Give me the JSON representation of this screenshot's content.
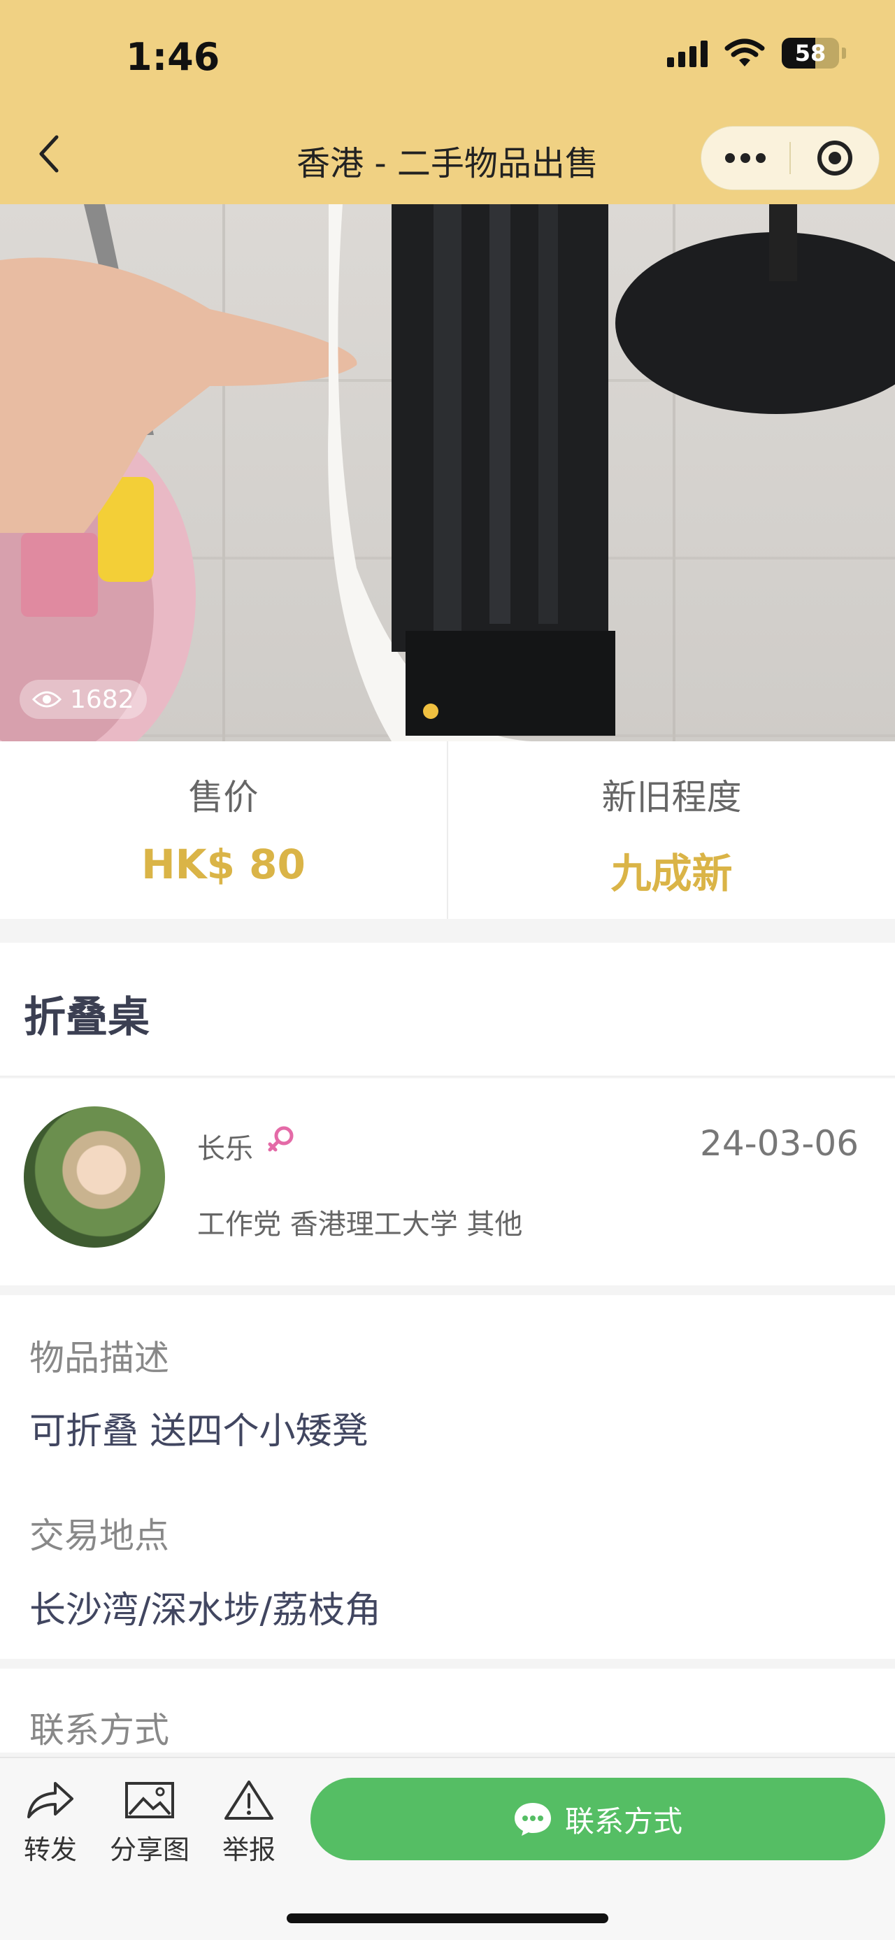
{
  "status": {
    "time": "1:46",
    "battery": "58",
    "battery_level": 0.58
  },
  "nav": {
    "title": "香港 - 二手物品出售"
  },
  "photo": {
    "views": "1682"
  },
  "price": {
    "label": "售价",
    "value": "HK$ 80"
  },
  "condition": {
    "label": "新旧程度",
    "value": "九成新"
  },
  "item": {
    "title": "折叠桌"
  },
  "seller": {
    "name": "长乐",
    "date": "24-03-06",
    "tags": "工作党 香港理工大学 其他"
  },
  "description": {
    "label": "物品描述",
    "value": "可折叠 送四个小矮凳"
  },
  "location": {
    "label": "交易地点",
    "value": "长沙湾/深水埗/荔枝角"
  },
  "contact_section": {
    "label": "联系方式"
  },
  "bottom": {
    "share": "转发",
    "share_image": "分享图",
    "report": "举报",
    "contact": "联系方式"
  },
  "colors": {
    "header": "#f0d183",
    "accent_gold": "#dab447",
    "contact_green": "#55be64"
  }
}
